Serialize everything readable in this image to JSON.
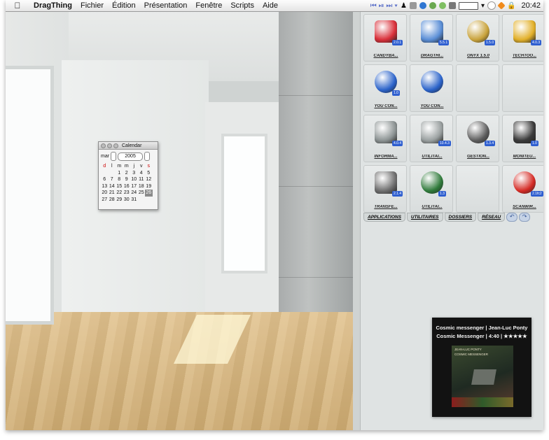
{
  "menubar": {
    "apple": "",
    "app": "DragThing",
    "menus": [
      "Fichier",
      "Édition",
      "Présentation",
      "Fenêtre",
      "Scripts",
      "Aide"
    ],
    "clock": "20:42"
  },
  "calendar": {
    "title": "Calendar",
    "month": "mar",
    "year": "2005",
    "weekdays": [
      "d",
      "l",
      "m",
      "m",
      "j",
      "v",
      "s"
    ],
    "rows": [
      [
        "",
        "",
        "1",
        "2",
        "3",
        "4",
        "5"
      ],
      [
        "6",
        "7",
        "8",
        "9",
        "10",
        "11",
        "12"
      ],
      [
        "13",
        "14",
        "15",
        "16",
        "17",
        "18",
        "19"
      ],
      [
        "20",
        "21",
        "22",
        "23",
        "24",
        "25",
        "26"
      ],
      [
        "27",
        "28",
        "29",
        "30",
        "31",
        "",
        ""
      ]
    ],
    "selected": "26"
  },
  "dock": {
    "items": [
      {
        "label": "CANDYBA...",
        "badge": "2.0.1",
        "icon": "candybar-icon",
        "color": "#d9303a"
      },
      {
        "label": "DRAGTHI...",
        "badge": "5.5.1",
        "icon": "dragthing-icon",
        "color": "#5a8ed6"
      },
      {
        "label": "ONYX 1.5.0",
        "badge": "1.5.0",
        "icon": "onyx-icon",
        "color": "#c8a23a"
      },
      {
        "label": "TECHTOO...",
        "badge": "4.0.3",
        "icon": "techtool-icon",
        "color": "#e2b02a"
      },
      {
        "label": "YOU CON...",
        "badge": "1.0",
        "icon": "youcontrol-icon",
        "color": "#2a62c9"
      },
      {
        "label": "YOU CON...",
        "badge": "",
        "icon": "youcontrol-tunes-icon",
        "color": "#2a62c9"
      },
      {
        "label": "",
        "badge": "",
        "icon": "",
        "color": ""
      },
      {
        "label": "",
        "badge": "",
        "icon": "",
        "color": ""
      },
      {
        "label": "INFORMA...",
        "badge": "4.0.4",
        "icon": "system-profiler-icon",
        "color": "#8d9494"
      },
      {
        "label": "UTILITAI...",
        "badge": "10.4.3",
        "icon": "disk-utility-icon",
        "color": "#9aa0a0"
      },
      {
        "label": "GESTION...",
        "badge": "1.3.4",
        "icon": "info-icon",
        "color": "#5c5c5c"
      },
      {
        "label": "MONITEU...",
        "badge": "1.0",
        "icon": "activity-monitor-icon",
        "color": "#3b3b3b"
      },
      {
        "label": "TRANSFE...",
        "badge": "2.1.4",
        "icon": "image-capture-icon",
        "color": "#707070"
      },
      {
        "label": "UTILITAI...",
        "badge": "1.3",
        "icon": "airport-utility-icon",
        "color": "#2f7a3a"
      },
      {
        "label": "",
        "badge": "",
        "icon": "",
        "color": ""
      },
      {
        "label": "SCANWIR...",
        "badge": "2.1fc2",
        "icon": "scanwizard-icon",
        "color": "#d42a24"
      }
    ],
    "tabs": [
      "APPLICATIONS",
      "UTILITAIRES",
      "DOSSIERS",
      "RÉSEAU"
    ]
  },
  "player": {
    "line1": "Cosmic messenger | Jean-Luc Ponty",
    "line2": "Cosmic Messenger | 4:40 | ★★★★★",
    "cover_text1": "JEAN-LUC PONTY",
    "cover_text2": "COSMIC MESSENGER"
  }
}
